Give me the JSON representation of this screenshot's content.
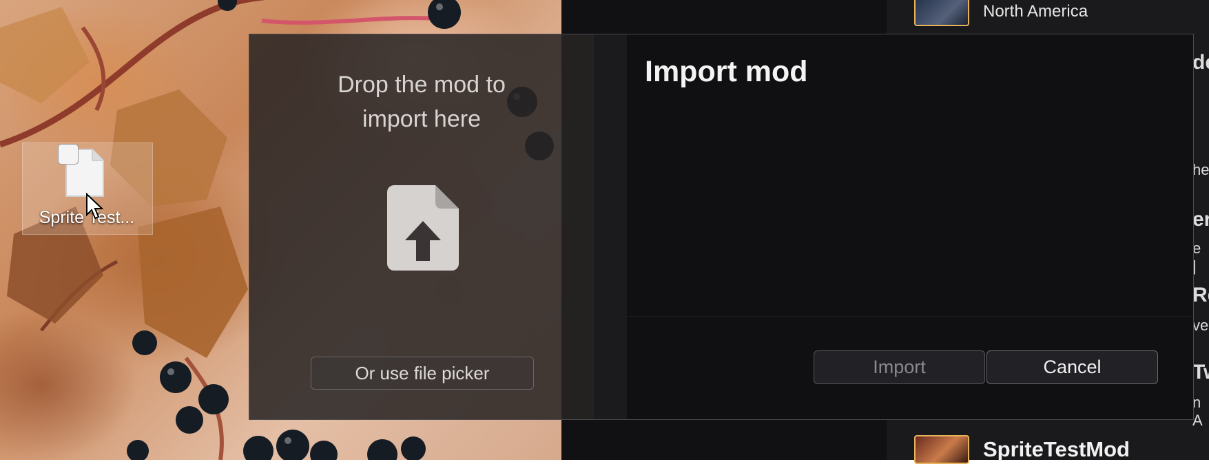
{
  "desktop": {
    "file_icon_label": "Sprite Test...",
    "file_icon": "file-icon"
  },
  "background_app": {
    "top_mod_subtitle": "North America",
    "bottom_mod_title": "SpriteTestMod",
    "edge_fragments": [
      "de",
      "her",
      "er",
      "e |",
      "Re",
      "ve",
      "Tw",
      "n A"
    ]
  },
  "dialog": {
    "drop_title_line1": "Drop the mod to",
    "drop_title_line2": "import here",
    "drop_icon": "file-upload-icon",
    "file_picker_label": "Or use file picker",
    "title": "Import mod",
    "import_label": "Import",
    "cancel_label": "Cancel"
  },
  "colors": {
    "dialog_bg": "#101012",
    "drop_zone_bg": "#2a2626",
    "accent_border": "#e9b35a",
    "button_bg": "#222226"
  }
}
